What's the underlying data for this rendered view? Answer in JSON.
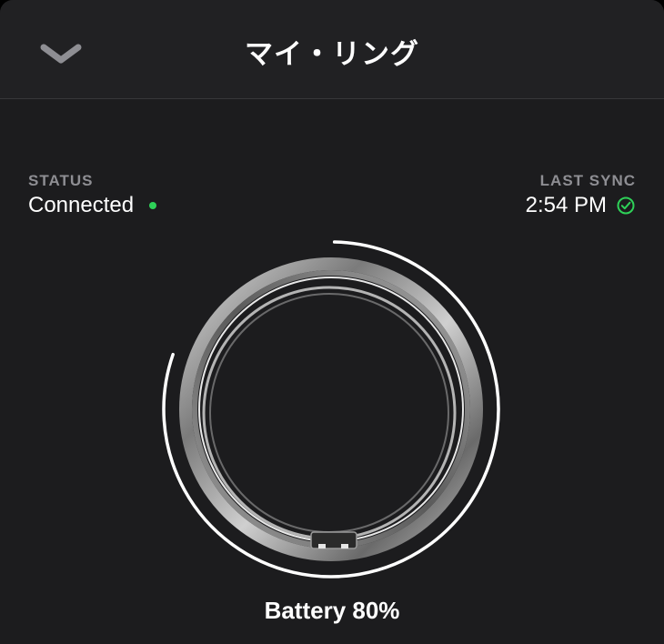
{
  "header": {
    "title": "マイ・リング",
    "collapse_icon": "chevron-down-icon"
  },
  "status": {
    "label": "STATUS",
    "value": "Connected",
    "dot_color": "#2ed158"
  },
  "last_sync": {
    "label": "LAST SYNC",
    "value": "2:54 PM",
    "icon": "check-circle-icon",
    "icon_color": "#2ed158"
  },
  "ring": {
    "image": "ring-image",
    "battery_level": 0.8
  },
  "battery": {
    "text": "Battery 80%"
  }
}
